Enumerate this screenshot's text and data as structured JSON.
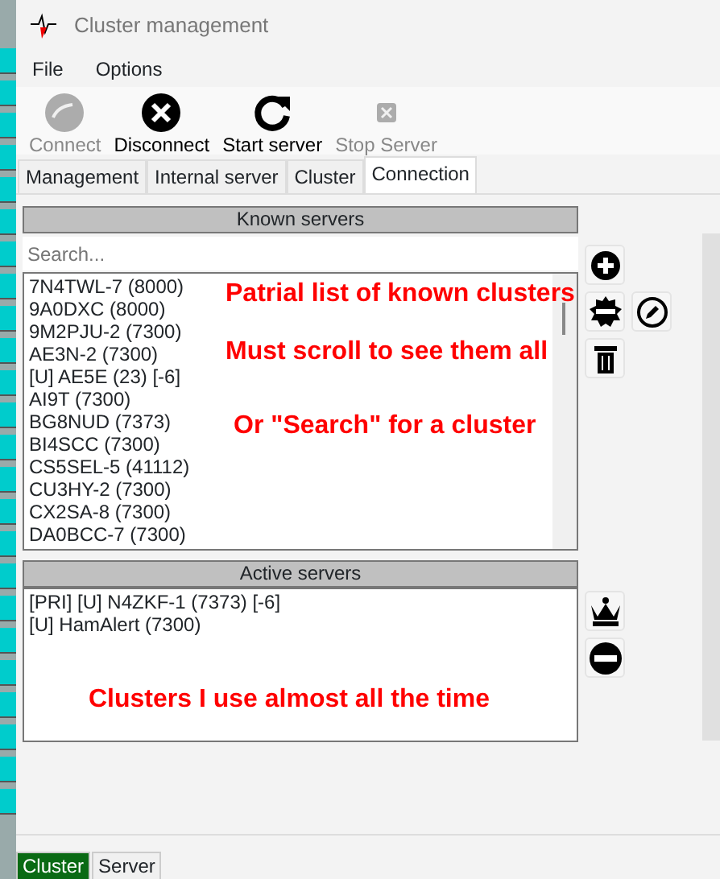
{
  "window": {
    "title": "Cluster management"
  },
  "menu": [
    "File",
    "Options"
  ],
  "toolbar": [
    {
      "label": "Connect",
      "kind": "connect",
      "disabled": true
    },
    {
      "label": "Disconnect",
      "kind": "disconnect",
      "disabled": false
    },
    {
      "label": "Start server",
      "kind": "start",
      "disabled": false
    },
    {
      "label": "Stop Server",
      "kind": "stop",
      "disabled": true
    }
  ],
  "tabs": [
    {
      "label": "Management",
      "selected": false
    },
    {
      "label": "Internal server",
      "selected": false
    },
    {
      "label": "Cluster",
      "selected": false
    },
    {
      "label": "Connection",
      "selected": true
    }
  ],
  "known_servers": {
    "title": "Known servers",
    "search": {
      "placeholder": "Search..."
    },
    "items": [
      "7N4TWL-7 (8000)",
      "9A0DXC (8000)",
      "9M2PJU-2 (7300)",
      "AE3N-2 (7300)",
      "[U] AE5E (23) [-6]",
      "AI9T (7300)",
      "BG8NUD (7373)",
      "BI4SCC (7300)",
      "CS5SEL-5 (41112)",
      "CU3HY-2 (7300)",
      "CX2SA-8 (7300)",
      "DA0BCC-7 (7300)"
    ],
    "annotations": [
      "Patrial list of known clusters",
      "Must scroll to see them all",
      "Or \"Search\" for a cluster"
    ]
  },
  "active_servers": {
    "title": "Active servers",
    "items": [
      "[PRI] [U] N4ZKF-1 (7373) [-6]",
      "[U] HamAlert (7300)"
    ],
    "annotations": [
      "Clusters I use almost all the time"
    ]
  },
  "bottom_tabs": [
    {
      "label": "Cluster",
      "selected": true
    },
    {
      "label": "Server",
      "selected": false
    }
  ]
}
